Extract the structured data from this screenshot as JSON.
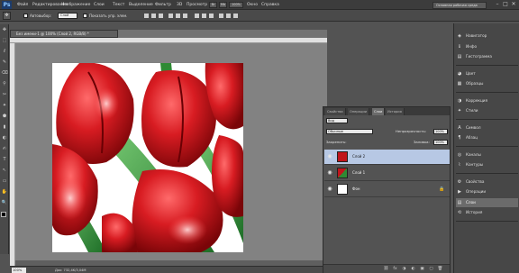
{
  "app": {
    "logo": "Ps"
  },
  "menu": {
    "items": [
      "Файл",
      "Редактирование",
      "Изображение",
      "Слои",
      "Текст",
      "Выделение",
      "Фильтр",
      "3D",
      "Просмотр",
      "Окно",
      "Справка"
    ],
    "mini_labels": [
      "Br",
      "Mb",
      "100%"
    ],
    "workspace": "Основная рабочая среда",
    "window_buttons": [
      "–",
      "□",
      "✕"
    ]
  },
  "options": {
    "autoselect_label": "Автовыбор:",
    "autoselect_value": "Слой",
    "show_controls_label": "Показать упр. элем.",
    "move_icon": "✥"
  },
  "tools": [
    "✥",
    "⬚",
    "ℓ",
    "✎",
    "⌫",
    "⚲",
    "✂",
    "✦",
    "⬟",
    "▮",
    "◐",
    "✍",
    "T",
    "↖",
    "▭",
    "✋",
    "🔍"
  ],
  "document": {
    "tab_title": "Без имени-1 @ 100% (Слой 2, RGB/8) *",
    "zoom": "100%",
    "doc_info": "Док: 732,4K/3,04M"
  },
  "layers_panel": {
    "tabs": [
      "Свойства",
      "Операции",
      "Слои",
      "История"
    ],
    "active_tab": "Слои",
    "kind_filter": "Вид",
    "blend_mode": "Обычные",
    "opacity_label": "Непрозрачность:",
    "opacity_value": "100%",
    "lock_label": "Закрепить:",
    "fill_label": "Заливка:",
    "fill_value": "100%",
    "layers": [
      {
        "name": "Слой 2",
        "selected": true
      },
      {
        "name": "Слой 1",
        "selected": false
      },
      {
        "name": "Фон",
        "selected": false
      }
    ],
    "footer_icons": [
      "⛓",
      "fx",
      "◑",
      "◐",
      "▣",
      "▢",
      "🗑"
    ]
  },
  "right_dock": {
    "groups": [
      [
        {
          "label": "Навигатор",
          "icon": "◈"
        },
        {
          "label": "Инфо",
          "icon": "ℹ"
        },
        {
          "label": "Гистограмма",
          "icon": "▤"
        }
      ],
      [
        {
          "label": "Цвет",
          "icon": "◕"
        },
        {
          "label": "Образцы",
          "icon": "▦"
        }
      ],
      [
        {
          "label": "Коррекция",
          "icon": "◑"
        },
        {
          "label": "Стили",
          "icon": "✦"
        }
      ],
      [
        {
          "label": "Символ",
          "icon": "A"
        },
        {
          "label": "Абзац",
          "icon": "¶"
        }
      ],
      [
        {
          "label": "Каналы",
          "icon": "◎"
        },
        {
          "label": "Контуры",
          "icon": "⌇"
        }
      ],
      [
        {
          "label": "Свойства",
          "icon": "⚙"
        },
        {
          "label": "Операции",
          "icon": "▶"
        },
        {
          "label": "Слои",
          "icon": "▤",
          "active": true
        },
        {
          "label": "История",
          "icon": "⟲"
        }
      ]
    ]
  },
  "colors": {
    "selected_layer": "#b7c8e4",
    "tulip_red": "#c0141b",
    "leaf_green": "#2e8a34"
  }
}
